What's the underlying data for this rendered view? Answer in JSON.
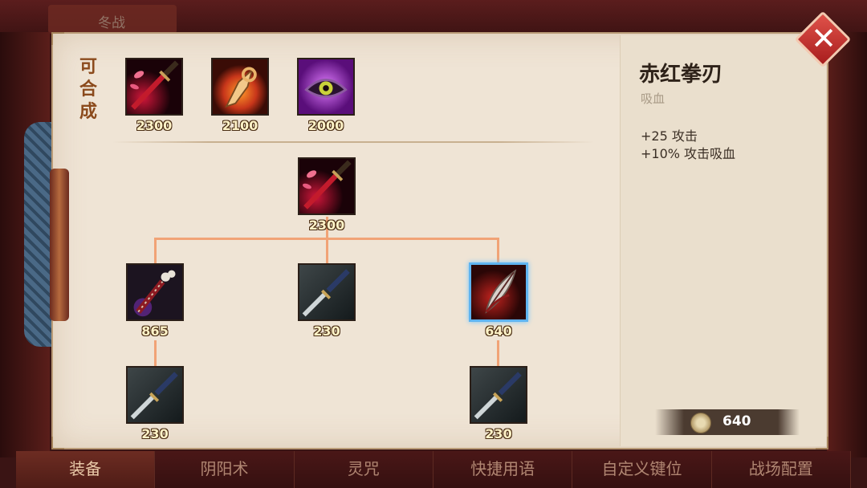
{
  "background_tab": {
    "label": "冬战"
  },
  "close_button": {
    "icon": "close-icon",
    "color": "#c0332d"
  },
  "craftable": {
    "label_chars": [
      "可",
      "合",
      "成"
    ],
    "items": [
      {
        "name": "crimson-fist-blade",
        "price": "2300"
      },
      {
        "name": "flame-dagger",
        "price": "2100"
      },
      {
        "name": "purple-eye-amulet",
        "price": "2000"
      }
    ]
  },
  "recipe_tree": {
    "root": {
      "name": "crimson-fist-blade",
      "price": "2300"
    },
    "children": [
      {
        "name": "bone-hilt-blade",
        "price": "865"
      },
      {
        "name": "plain-sword",
        "price": "230"
      },
      {
        "name": "red-feather",
        "price": "640",
        "selected": true
      }
    ],
    "grandchildren": [
      {
        "name": "plain-sword",
        "price": "230"
      },
      {
        "name": "plain-sword",
        "price": "230"
      }
    ],
    "line_color": "#f1a376"
  },
  "detail": {
    "name": "赤红拳刃",
    "tag": "吸血",
    "stats": [
      "+25 攻击",
      "+10% 攻击吸血"
    ]
  },
  "gold": {
    "value": "640"
  },
  "bottom_tabs": [
    "装备",
    "阴阳术",
    "灵咒",
    "快捷用语",
    "自定义键位",
    "战场配置"
  ],
  "active_tab": "装备"
}
